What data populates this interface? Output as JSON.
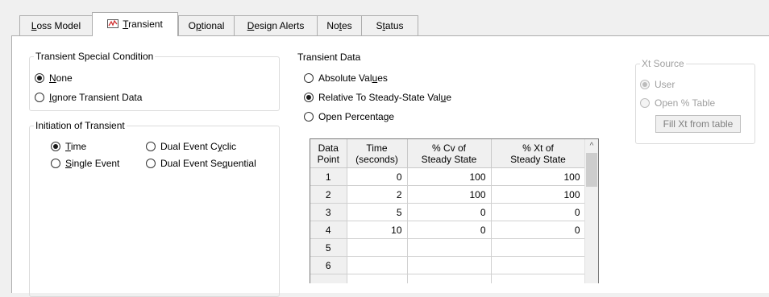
{
  "tabs": [
    {
      "label": "Loss Model",
      "mnemonic": "L",
      "rest": "oss Model",
      "active": false
    },
    {
      "label": "Transient",
      "mnemonic": "T",
      "rest": "ransient",
      "active": true,
      "icon": "transient-chart-icon"
    },
    {
      "label": "Optional",
      "pre": "O",
      "mnemonic": "p",
      "rest": "tional",
      "active": false
    },
    {
      "label": "Design Alerts",
      "mnemonic": "D",
      "rest": "esign Alerts",
      "active": false
    },
    {
      "label": "Notes",
      "pre": "No",
      "mnemonic": "t",
      "rest": "es",
      "active": false
    },
    {
      "label": "Status",
      "pre": "S",
      "mnemonic": "t",
      "rest": "atus",
      "active": false
    }
  ],
  "special_condition": {
    "title": "Transient Special Condition",
    "options": [
      {
        "pre": "",
        "mnemonic": "N",
        "rest": "one",
        "selected": true
      },
      {
        "pre": "",
        "mnemonic": "I",
        "rest": "gnore Transient Data",
        "selected": false
      }
    ]
  },
  "initiation": {
    "title": "Initiation of Transient",
    "options": [
      {
        "pre": "",
        "mnemonic": "T",
        "rest": "ime",
        "selected": true
      },
      {
        "pre": "Dual Event C",
        "mnemonic": "y",
        "rest": "clic",
        "selected": false
      },
      {
        "pre": "",
        "mnemonic": "S",
        "rest": "ingle Event",
        "selected": false
      },
      {
        "pre": "Dual Event Se",
        "mnemonic": "q",
        "rest": "uential",
        "selected": false
      }
    ]
  },
  "transient_data": {
    "title": "Transient Data",
    "options": [
      {
        "pre": "Absolute Val",
        "mnemonic": "u",
        "rest": "es",
        "selected": false
      },
      {
        "pre": "Relative To Steady-State Val",
        "mnemonic": "u",
        "rest": "e",
        "selected": true
      },
      {
        "pre": "Open Percentage",
        "mnemonic": "",
        "rest": "",
        "selected": false
      }
    ]
  },
  "xt_source": {
    "title": "Xt Source",
    "options": [
      {
        "label": "User",
        "selected": true
      },
      {
        "label": "Open % Table",
        "selected": false
      }
    ],
    "button": "Fill Xt from table"
  },
  "grid": {
    "headers": [
      [
        "Data",
        "Point"
      ],
      [
        "Time",
        "(seconds)"
      ],
      [
        "% Cv of",
        "Steady State"
      ],
      [
        "% Xt of",
        "Steady State"
      ]
    ],
    "rows": [
      [
        "1",
        "0",
        "100",
        "100"
      ],
      [
        "2",
        "2",
        "100",
        "100"
      ],
      [
        "3",
        "5",
        "0",
        "0"
      ],
      [
        "4",
        "10",
        "0",
        "0"
      ],
      [
        "5",
        "",
        "",
        ""
      ],
      [
        "6",
        "",
        "",
        ""
      ],
      [
        "",
        "",
        "",
        ""
      ]
    ],
    "scroll_up_glyph": "^"
  }
}
